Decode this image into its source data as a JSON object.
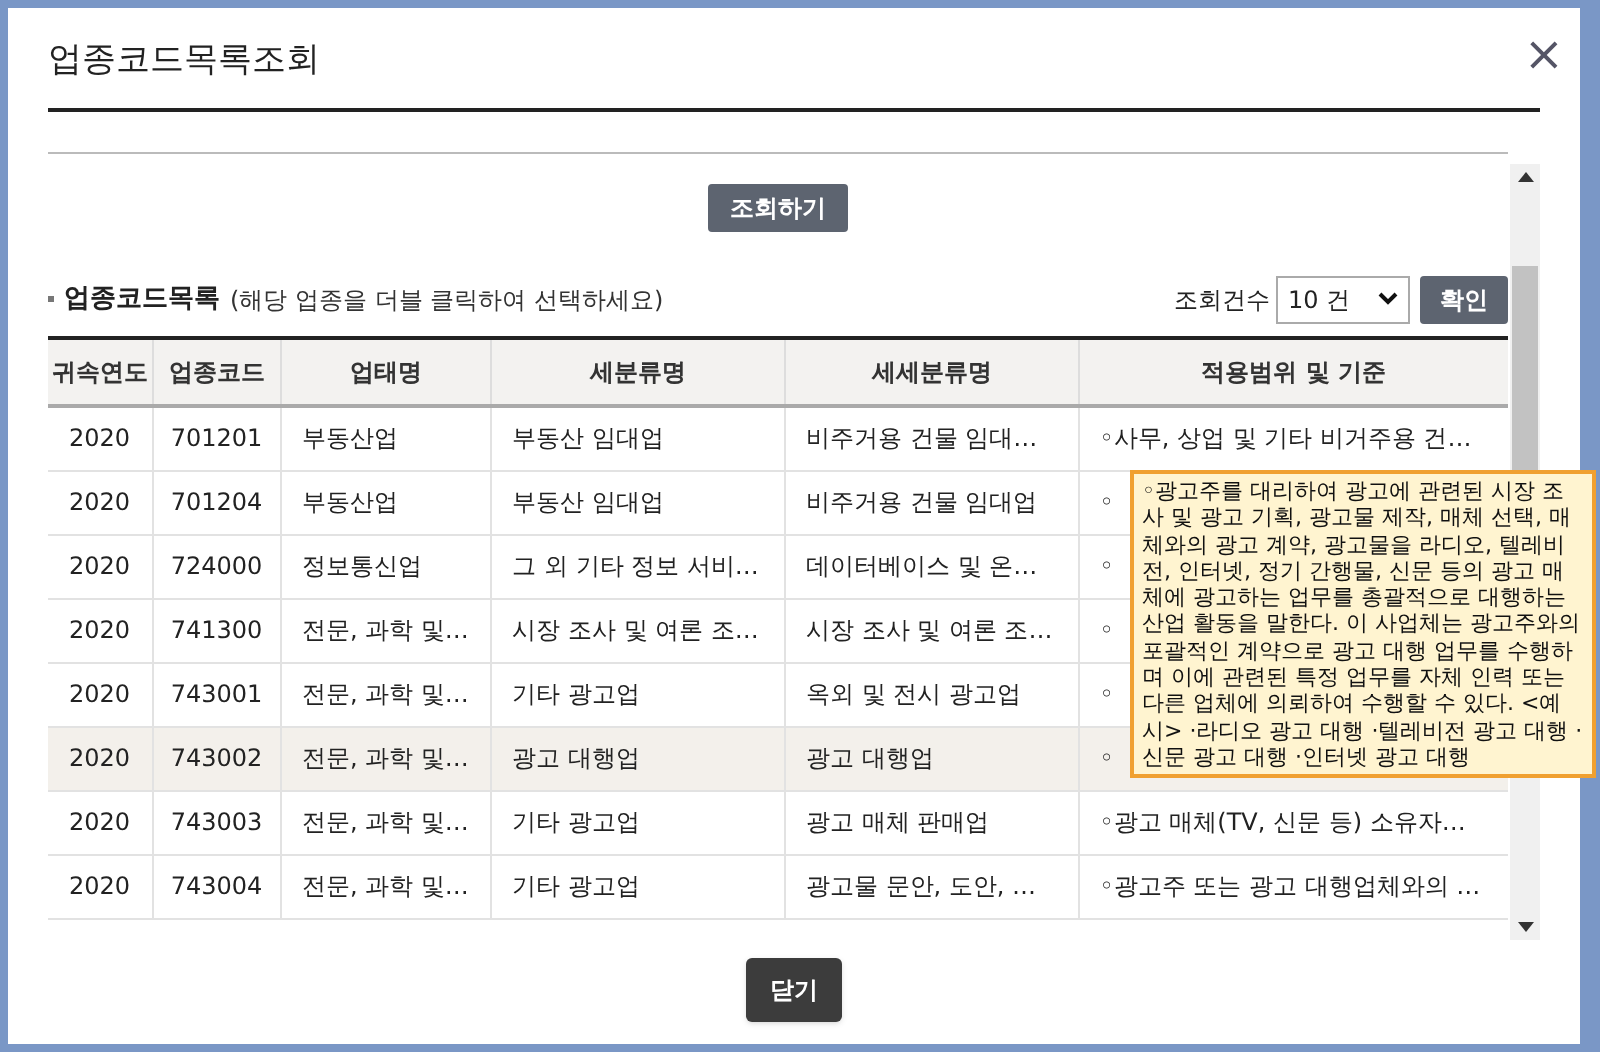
{
  "dialog": {
    "title": "업종코드목록조회",
    "close": "×"
  },
  "search_button": "조회하기",
  "section": {
    "title": "업종코드목록",
    "hint": "(해당 업종을 더블 클릭하여 선택하세요)"
  },
  "count": {
    "label": "조회건수",
    "value": "10 건",
    "button": "확인"
  },
  "table": {
    "columns": [
      "귀속연도",
      "업종코드",
      "업태명",
      "세분류명",
      "세세분류명",
      "적용범위 및 기준"
    ],
    "rows": [
      {
        "cells": [
          "2020",
          "701201",
          "부동산업",
          "부동산 임대업",
          "비주거용 건물 임대…",
          "◦사무, 상업 및 기타 비거주용 건…"
        ],
        "selected": false
      },
      {
        "cells": [
          "2020",
          "701204",
          "부동산업",
          "부동산 임대업",
          "비주거용 건물 임대업",
          "◦"
        ],
        "selected": false
      },
      {
        "cells": [
          "2020",
          "724000",
          "정보통신업",
          "그 외 기타 정보 서비…",
          "데이터베이스 및 온…",
          "◦"
        ],
        "selected": false
      },
      {
        "cells": [
          "2020",
          "741300",
          "전문, 과학 및…",
          "시장 조사 및 여론 조…",
          "시장 조사 및 여론 조…",
          "◦"
        ],
        "selected": false
      },
      {
        "cells": [
          "2020",
          "743001",
          "전문, 과학 및…",
          "기타 광고업",
          "옥외 및 전시 광고업",
          "◦"
        ],
        "selected": false
      },
      {
        "cells": [
          "2020",
          "743002",
          "전문, 과학 및…",
          "광고 대행업",
          "광고 대행업",
          "◦"
        ],
        "selected": true
      },
      {
        "cells": [
          "2020",
          "743003",
          "전문, 과학 및…",
          "기타 광고업",
          "광고 매체 판매업",
          "◦광고 매체(TV, 신문 등) 소유자…"
        ],
        "selected": false
      },
      {
        "cells": [
          "2020",
          "743004",
          "전문, 과학 및…",
          "기타 광고업",
          "광고물 문안, 도안, …",
          "◦광고주 또는 광고 대행업체와의 …"
        ],
        "selected": false
      }
    ]
  },
  "tooltip": "◦광고주를 대리하여 광고에 관련된 시장 조사 및 광고 기획, 광고물 제작, 매체 선택, 매체와의 광고 계약, 광고물을 라디오, 텔레비전, 인터넷, 정기 간행물, 신문 등의 광고 매체에 광고하는 업무를 총괄적으로 대행하는 산업 활동을 말한다. 이 사업체는 광고주와의 포괄적인 계약으로 광고 대행 업무를 수행하며 이에 관련된 특정 업무를 자체 인력 또는 다른 업체에 의뢰하여 수행할 수 있다. <예 시> ·라디오 광고 대행 ·텔레비전 광고 대행 ·신문 광고 대행 ·인터넷 광고 대행",
  "close_button": "닫기"
}
